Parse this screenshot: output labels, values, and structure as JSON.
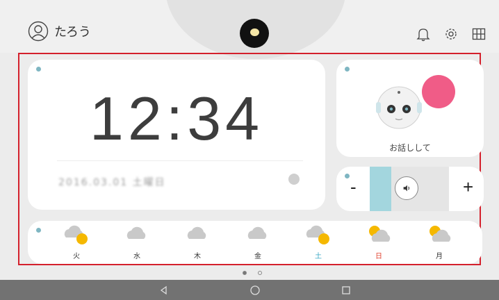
{
  "header": {
    "username": "たろう",
    "icons": [
      "user-icon",
      "robot-logo-icon",
      "bell-icon",
      "gear-icon",
      "grid-icon"
    ]
  },
  "clock": {
    "time": "12:34",
    "date": "2016.03.01 土曜日"
  },
  "talk": {
    "label": "お話しして"
  },
  "volume": {
    "minus": "-",
    "plus": "+",
    "level": 0.27
  },
  "weather": {
    "days": [
      {
        "label": "火",
        "icon": "cloud-sun-icon",
        "color": "#333333"
      },
      {
        "label": "水",
        "icon": "cloud-icon",
        "color": "#333333"
      },
      {
        "label": "木",
        "icon": "cloud-icon",
        "color": "#333333"
      },
      {
        "label": "金",
        "icon": "cloud-icon",
        "color": "#333333"
      },
      {
        "label": "土",
        "icon": "cloud-sun-icon",
        "color": "#39a7c4"
      },
      {
        "label": "日",
        "icon": "sun-cloud-icon",
        "color": "#e0412f"
      },
      {
        "label": "月",
        "icon": "sun-cloud-icon",
        "color": "#333333"
      }
    ]
  },
  "pager": {
    "pages": 2,
    "active": 0
  },
  "colors": {
    "accent": "#d4202c",
    "card_dot": "#7fb6c2",
    "volume_fill": "#a3d6de",
    "bubble": "#f05c87",
    "sun": "#f5b800",
    "cloud": "#c9c9c9"
  },
  "navbar": {
    "buttons": [
      "back-icon",
      "home-icon",
      "recents-icon"
    ]
  }
}
